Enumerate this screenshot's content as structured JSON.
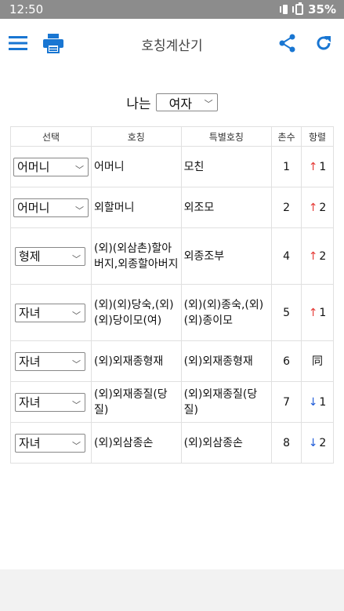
{
  "status_bar": {
    "time": "12:50",
    "battery": "35%"
  },
  "app_bar": {
    "title": "호칭계산기"
  },
  "gender": {
    "label": "나는",
    "value": "여자"
  },
  "table": {
    "headers": [
      "선택",
      "호칭",
      "특별호칭",
      "촌수",
      "항렬"
    ],
    "rows": [
      {
        "select": "어머니",
        "name": "어머니",
        "special": "모친",
        "chon": "1",
        "arrow": "↑",
        "dir": "up",
        "level": "1"
      },
      {
        "select": "어머니",
        "name": "외할머니",
        "special": "외조모",
        "chon": "2",
        "arrow": "↑",
        "dir": "up",
        "level": "2"
      },
      {
        "select": "형제",
        "name": "(외)(외삼촌)할아버지,외종할아버지",
        "special": "외종조부",
        "chon": "4",
        "arrow": "↑",
        "dir": "up",
        "level": "2"
      },
      {
        "select": "자녀",
        "name": "(외)(외)당숙,(외)(외)당이모(여)",
        "special": "(외)(외)종숙,(외)(외)종이모",
        "chon": "5",
        "arrow": "↑",
        "dir": "up",
        "level": "1"
      },
      {
        "select": "자녀",
        "name": "(외)외재종형재",
        "special": "(외)외재종형재",
        "chon": "6",
        "arrow": "",
        "dir": "same",
        "level": "同"
      },
      {
        "select": "자녀",
        "name": "(외)외재종질(당질)",
        "special": "(외)외재종질(당질)",
        "chon": "7",
        "arrow": "↓",
        "dir": "down",
        "level": "1"
      },
      {
        "select": "자녀",
        "name": "(외)외삼종손",
        "special": "(외)외삼종손",
        "chon": "8",
        "arrow": "↓",
        "dir": "down",
        "level": "2"
      }
    ]
  },
  "colors": {
    "accent": "#1976d2",
    "up": "#e53935",
    "down": "#1e5bd8"
  },
  "icons": [
    "menu-icon",
    "print-icon",
    "share-icon",
    "refresh-icon",
    "chevron-down-icon"
  ]
}
